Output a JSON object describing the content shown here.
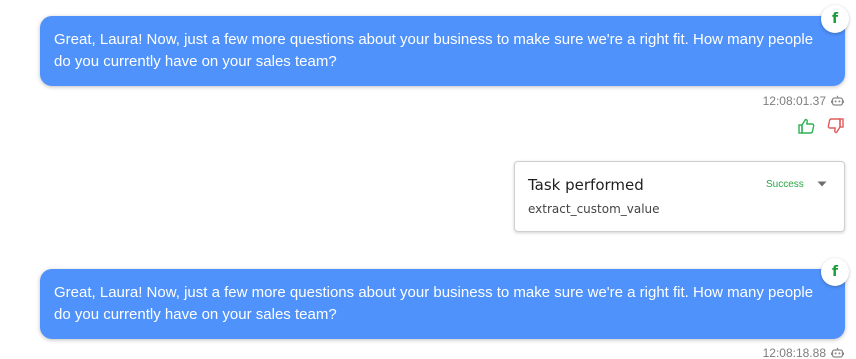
{
  "messages": [
    {
      "text": "Great, Laura! Now, just a few more questions about your business to make sure we're a right fit. How many people do you currently have on your sales team?",
      "avatar_letter": "f",
      "timestamp": "12:08:01.37"
    },
    {
      "text": "Great, Laura! Now, just a few more questions about your business to make sure we're a right fit. How many people do you currently have on your sales team?",
      "avatar_letter": "f",
      "timestamp": "12:08:18.88"
    }
  ],
  "task": {
    "title": "Task performed",
    "status": "Success",
    "detail": "extract_custom_value"
  },
  "icons": {
    "avatar": "brand-f-icon",
    "meta": "bot-icon",
    "like": "thumbs-up-icon",
    "dislike": "thumbs-down-icon",
    "expand": "chevron-down-icon"
  },
  "colors": {
    "bubble": "#4f92fb",
    "success": "#29a745",
    "like": "#2fb155",
    "dislike": "#e05b5b"
  }
}
